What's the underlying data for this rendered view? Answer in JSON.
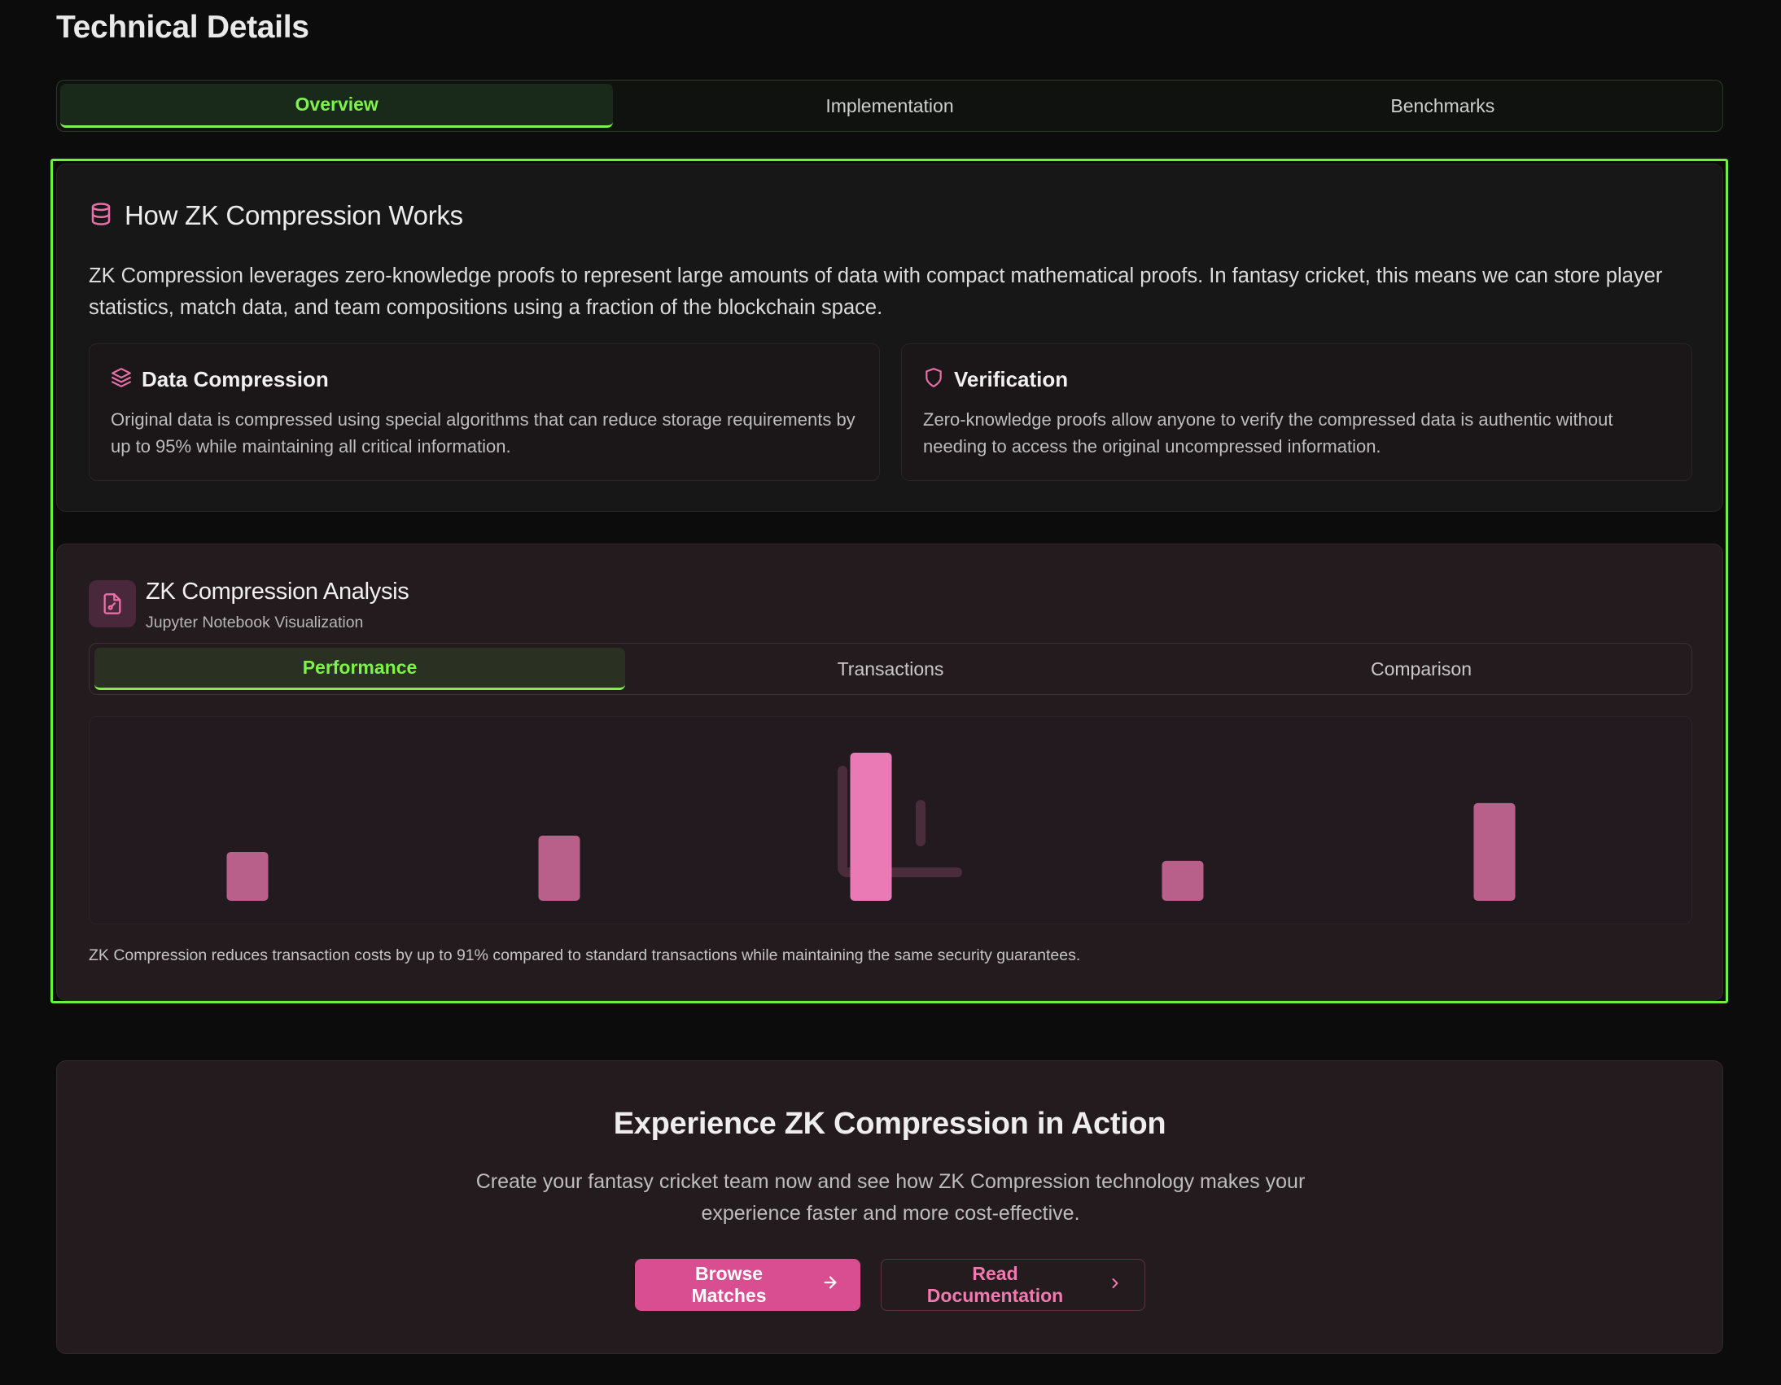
{
  "page": {
    "title": "Technical Details"
  },
  "tabs": [
    "Overview",
    "Implementation",
    "Benchmarks"
  ],
  "active_tab": "Overview",
  "how_it_works": {
    "icon": "database-icon",
    "title": "How ZK Compression Works",
    "description": "ZK Compression leverages zero-knowledge proofs to represent large amounts of data with compact mathematical proofs. In fantasy cricket, this means we can store player statistics, match data, and team compositions using a fraction of the blockchain space.",
    "cards": [
      {
        "icon": "layers-icon",
        "title": "Data Compression",
        "text": "Original data is compressed using special algorithms that can reduce storage requirements by up to 95% while maintaining all critical information."
      },
      {
        "icon": "shield-icon",
        "title": "Verification",
        "text": "Zero-knowledge proofs allow anyone to verify the compressed data is authentic without needing to access the original uncompressed information."
      }
    ]
  },
  "analysis": {
    "icon": "file-chart-icon",
    "title": "ZK Compression Analysis",
    "subtitle": "Jupyter Notebook Visualization",
    "tabs": [
      "Performance",
      "Transactions",
      "Comparison"
    ],
    "active_tab": "Performance",
    "note": "ZK Compression reduces transaction costs by up to 91% compared to standard transactions while maintaining the same security guarantees."
  },
  "chart_data": {
    "type": "bar",
    "values": [
      0.33,
      0.44,
      1.0,
      0.27,
      0.66
    ],
    "highlight_index": 2,
    "colors": {
      "bar": "#b8608a",
      "highlight": "#e97ab5",
      "watermark": "#4a2c3b"
    },
    "watermark_icon": "bar-chart-icon"
  },
  "cta": {
    "title": "Experience ZK Compression in Action",
    "description": "Create your fantasy cricket team now and see how ZK Compression technology makes your experience faster and more cost-effective.",
    "primary_button": "Browse Matches",
    "secondary_button": "Read Documentation"
  },
  "colors": {
    "accent_green": "#7ef24a",
    "accent_pink": "#d94d91",
    "background": "#0c0c0c"
  }
}
